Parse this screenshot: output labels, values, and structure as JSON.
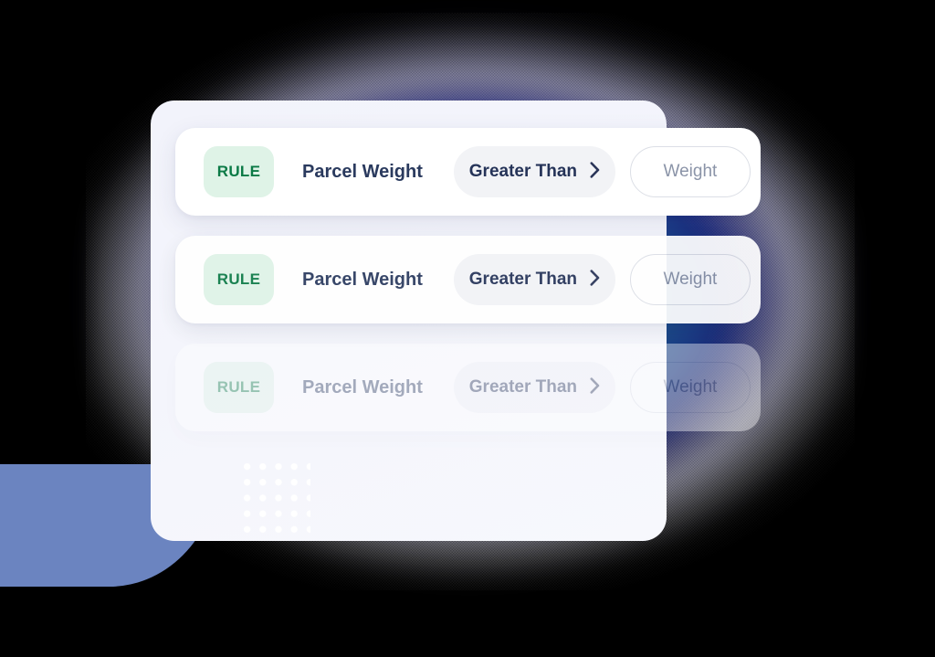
{
  "panel": {
    "name": "rules-panel",
    "background_color": "#f4f5fc",
    "dot_grid": {
      "name": "dot-grid-decoration",
      "columns": 5,
      "rows": 6,
      "dot_color": "#ffffff"
    }
  },
  "decorations": {
    "blue_shape_color": "#6b84c0",
    "glow_colors": [
      "#2e2cbe",
      "#107a78"
    ]
  },
  "icons": {
    "chevron_right": "chevron-right-icon"
  },
  "colors": {
    "badge_bg": "#dff3e7",
    "badge_text": "#0b7a46",
    "field_text": "#2a3a5e",
    "operator_bg": "#f2f3f6",
    "operator_text": "#253358",
    "input_border": "#dcdfe6",
    "input_placeholder": "#8b94a8"
  },
  "rules": [
    {
      "badge_label": "RULE",
      "field_label": "Parcel Weight",
      "operator_label": "Greater Than",
      "value": "",
      "value_placeholder": "Weight",
      "state": "active"
    },
    {
      "badge_label": "RULE",
      "field_label": "Parcel Weight",
      "operator_label": "Greater Than",
      "value": "",
      "value_placeholder": "Weight",
      "state": "active"
    },
    {
      "badge_label": "RULE",
      "field_label": "Parcel Weight",
      "operator_label": "Greater Than",
      "value": "",
      "value_placeholder": "Weight",
      "state": "faded"
    }
  ]
}
